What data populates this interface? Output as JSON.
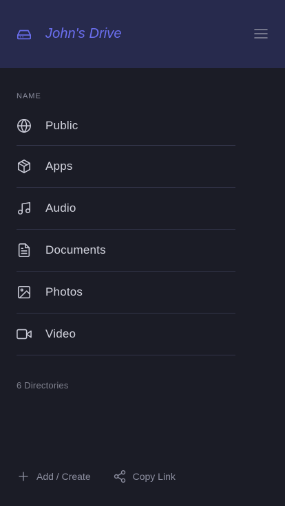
{
  "header": {
    "title": "John's Drive",
    "icon": "drive-icon",
    "menu_icon": "hamburger-menu-icon"
  },
  "list": {
    "column_header": "NAME",
    "items": [
      {
        "label": "Public",
        "icon": "globe-icon"
      },
      {
        "label": "Apps",
        "icon": "package-icon"
      },
      {
        "label": "Audio",
        "icon": "music-icon"
      },
      {
        "label": "Documents",
        "icon": "document-icon"
      },
      {
        "label": "Photos",
        "icon": "image-icon"
      },
      {
        "label": "Video",
        "icon": "video-icon"
      }
    ],
    "count_text": "6 Directories"
  },
  "footer": {
    "add_label": "Add / Create",
    "copy_label": "Copy Link",
    "add_icon": "plus-icon",
    "copy_icon": "share-icon"
  },
  "colors": {
    "background": "#1b1c26",
    "header_background": "#272a4d",
    "accent": "#6b6ff0",
    "divider": "#33354a"
  }
}
